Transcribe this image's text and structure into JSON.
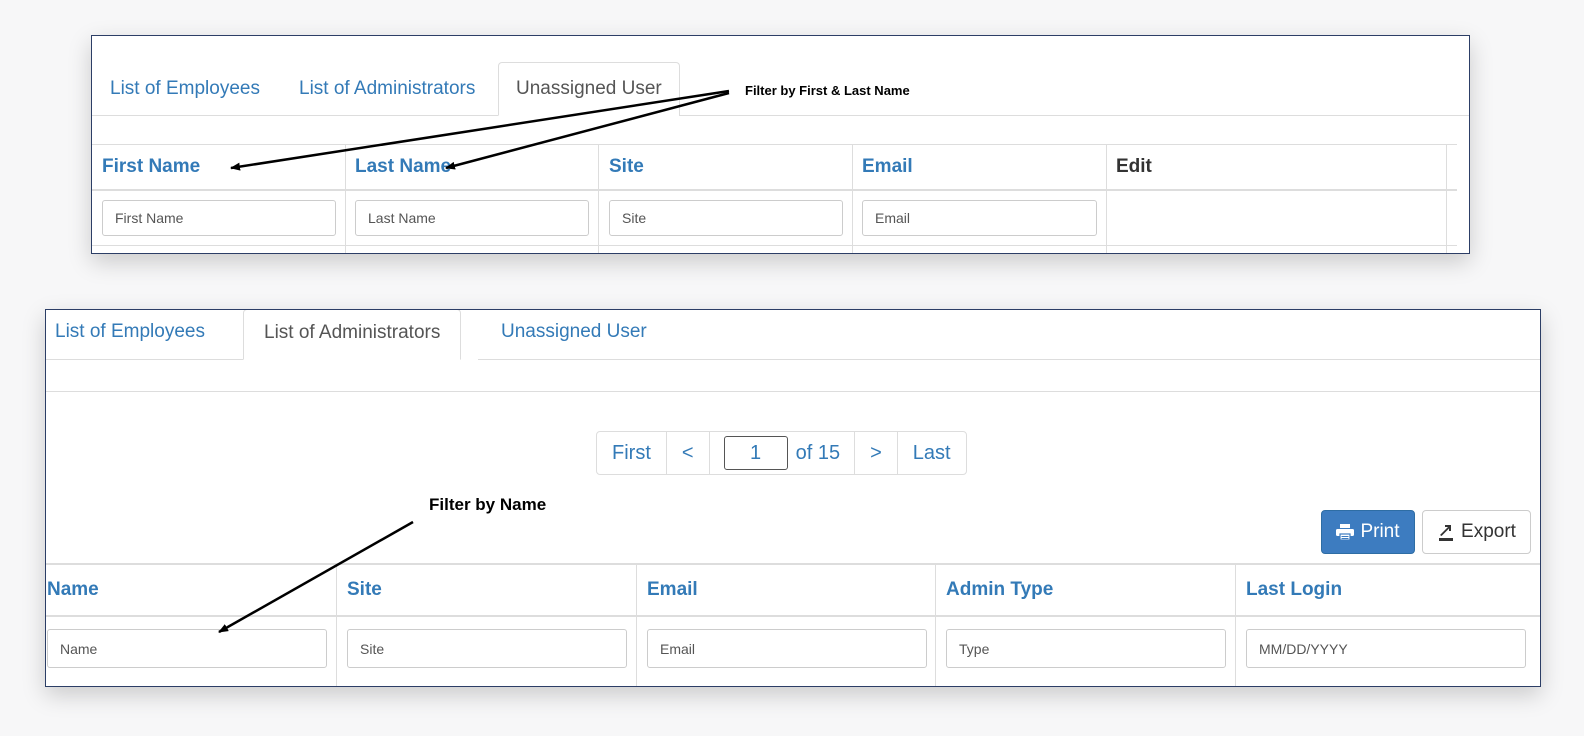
{
  "top_panel": {
    "tabs": [
      {
        "label": "List of Employees",
        "active": false
      },
      {
        "label": "List of Administrators",
        "active": false
      },
      {
        "label": "Unassigned User",
        "active": true
      }
    ],
    "columns": [
      "First Name",
      "Last Name",
      "Site",
      "Email",
      "Edit"
    ],
    "filters": [
      {
        "placeholder": "First Name"
      },
      {
        "placeholder": "Last Name"
      },
      {
        "placeholder": "Site"
      },
      {
        "placeholder": "Email"
      }
    ],
    "annotation": "Filter by First & Last Name"
  },
  "bottom_panel": {
    "tabs": [
      {
        "label": "List of Employees",
        "active": false
      },
      {
        "label": "List of Administrators",
        "active": true
      },
      {
        "label": "Unassigned User",
        "active": false
      }
    ],
    "pagination": {
      "first": "First",
      "prev": "<",
      "current_page": "1",
      "of_total": "of 15",
      "next": ">",
      "last": "Last"
    },
    "buttons": {
      "print": "Print",
      "export": "Export"
    },
    "columns": [
      "Name",
      "Site",
      "Email",
      "Admin Type",
      "Last Login"
    ],
    "filters": [
      {
        "placeholder": "Name"
      },
      {
        "placeholder": "Site"
      },
      {
        "placeholder": "Email"
      },
      {
        "placeholder": "Type"
      },
      {
        "placeholder": "MM/DD/YYYY"
      }
    ],
    "annotation": "Filter by Name"
  },
  "icons": {
    "print": "printer-icon",
    "export": "export-icon",
    "annotation_arrow": "arrow-icon"
  },
  "colors": {
    "link": "#337ab7",
    "print_button": "#3d7cc0",
    "panel_border": "#2c3e66"
  }
}
